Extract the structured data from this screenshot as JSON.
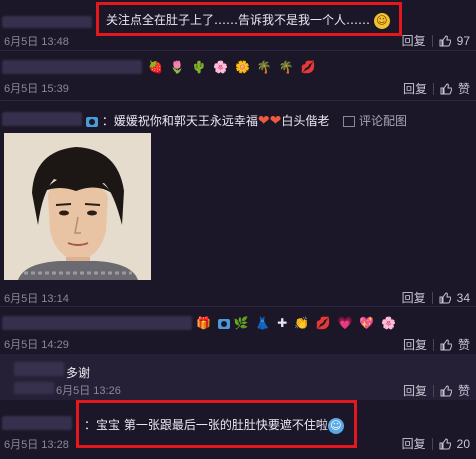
{
  "comments": [
    {
      "id": "c1",
      "text": "关注点全在肚子上了……告诉我不是我一个人……",
      "time": "6月5日 13:48",
      "reply": "回复",
      "likes": "97"
    },
    {
      "id": "c2",
      "emojis": [
        "🍓",
        "🌷",
        "🌵",
        "🌸",
        "🌼",
        "🌴",
        "🌴",
        "💋"
      ],
      "time": "6月5日 15:39",
      "reply": "回复",
      "likes": "赞"
    },
    {
      "id": "c3",
      "text": "：媛媛祝你和郭天王永远幸福",
      "text_tail": "白头偕老",
      "review_image": "评论配图",
      "time": "6月5日 13:14",
      "reply": "回复",
      "likes": "34"
    },
    {
      "id": "c4",
      "emojis": [
        "🌿",
        "👗",
        "✚",
        "👏",
        "💋",
        "💗",
        "💖",
        "🌸"
      ],
      "time": "6月5日 14:29",
      "reply": "回复",
      "likes": "赞"
    },
    {
      "id": "c4r",
      "text": "多谢",
      "time": "6月5日 13:26",
      "reply": "回复",
      "likes": "赞"
    },
    {
      "id": "c5",
      "text": "：宝宝 第一张跟最后一张的肚肚快要遮不住啦",
      "time": "6月5日 13:28",
      "reply": "回复",
      "likes": "20"
    }
  ],
  "colors": {
    "highlight": "#e4171c",
    "background": "#1b1628"
  }
}
